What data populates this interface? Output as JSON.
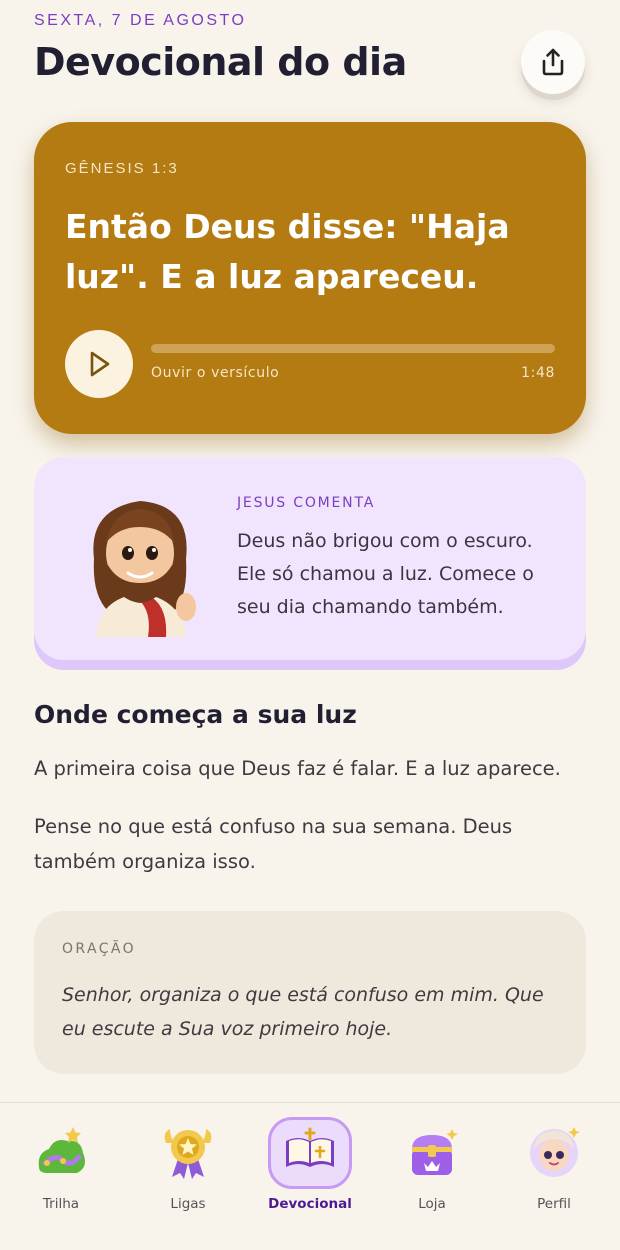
{
  "header": {
    "date": "SEXTA, 7 DE AGOSTO",
    "title": "Devocional do dia",
    "share_icon": "share-icon"
  },
  "verse": {
    "reference": "GÊNESIS 1:3",
    "text": "Então Deus disse: \"Haja luz\". E a luz apareceu.",
    "audio_label": "Ouvir o versículo",
    "duration": "1:48",
    "progress": 0,
    "play_icon": "play-icon"
  },
  "comment": {
    "label": "JESUS COMENTA",
    "text": "Deus não brigou com o escuro. Ele só chamou a luz. Comece o seu dia chamando também.",
    "avatar_icon": "jesus-avatar"
  },
  "reflection": {
    "title": "Onde começa a sua luz",
    "paragraphs": [
      "A primeira coisa que Deus faz é falar. E a luz aparece.",
      "Pense no que está confuso na sua semana. Deus também organiza isso."
    ]
  },
  "prayer": {
    "label": "ORAÇÃO",
    "text": "Senhor, organiza o que está confuso em mim. Que eu escute a Sua voz primeiro hoje."
  },
  "nav": {
    "active": "Devocional",
    "items": [
      {
        "label": "Trilha",
        "icon": "trail-icon"
      },
      {
        "label": "Ligas",
        "icon": "medal-icon"
      },
      {
        "label": "Devocional",
        "icon": "bible-icon"
      },
      {
        "label": "Loja",
        "icon": "chest-icon"
      },
      {
        "label": "Perfil",
        "icon": "profile-icon"
      }
    ]
  },
  "colors": {
    "accent": "#7a3ec4",
    "verse_card": "#b47b12",
    "comment_card": "#f1e5fd",
    "prayer_card": "#efe8dc",
    "background": "#f8f4ec"
  }
}
